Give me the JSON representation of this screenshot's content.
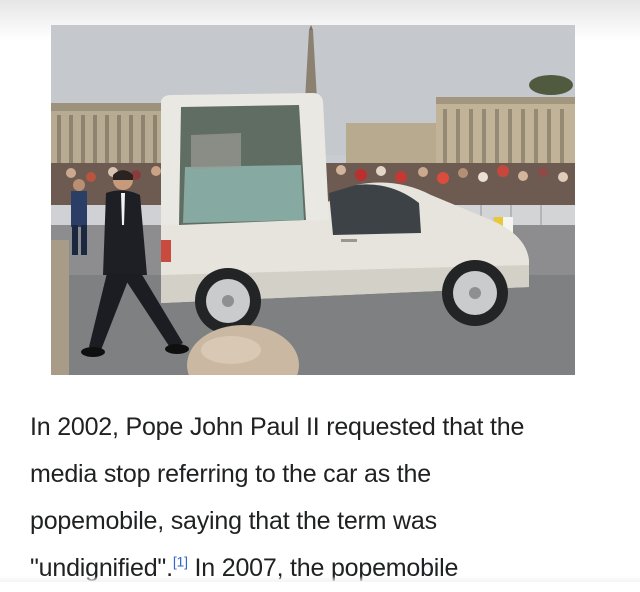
{
  "article": {
    "line1": "In 2002, Pope John Paul II requested that the",
    "line2": "media stop referring to the car as the",
    "line3": "popemobile, saying that the term was",
    "line4_quote": "\"undignified\".",
    "citation": "[1]",
    "line4_rest": " In 2007, the popemobile"
  },
  "image": {
    "subject": "popemobile-photo"
  },
  "colors": {
    "text": "#202122",
    "link": "#3366cc"
  }
}
